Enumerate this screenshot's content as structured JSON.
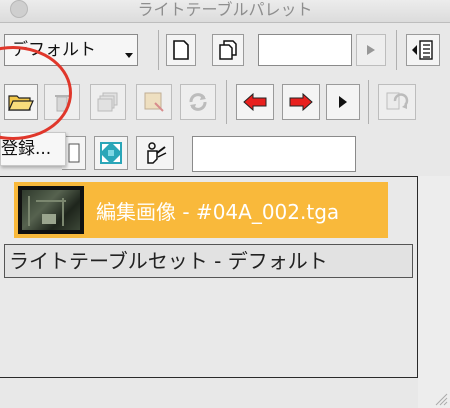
{
  "window": {
    "title": "ライトテーブルパレット"
  },
  "toolbar": {
    "preset_dropdown": {
      "selected": "デフォルト"
    },
    "name_field_value": "",
    "search_field_value": ""
  },
  "tooltip": {
    "text": "登録..."
  },
  "list": {
    "items": [
      {
        "label": "編集画像 - #04A_002.tga",
        "selected": true
      },
      {
        "label": "ライトテーブルセット - デフォルト",
        "selected": false
      }
    ]
  },
  "colors": {
    "selection": "#f9b93b",
    "arrow_red": "#e8201e",
    "annotation": "#e0372b"
  }
}
